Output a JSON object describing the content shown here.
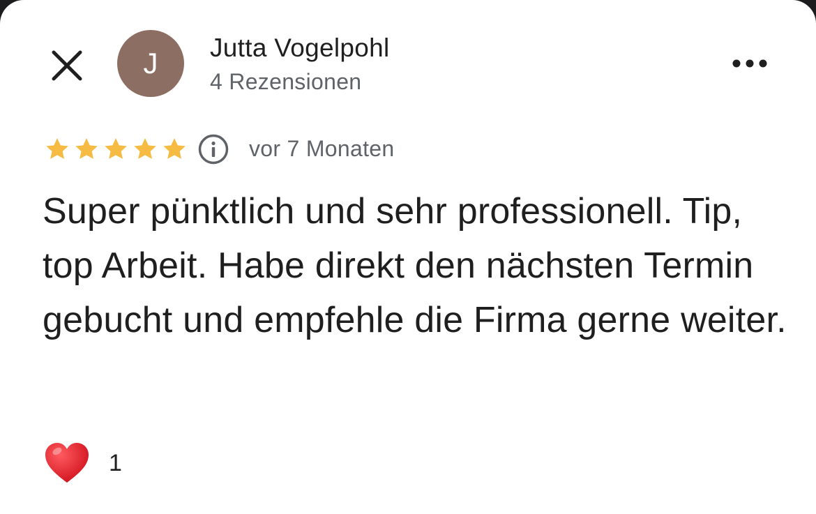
{
  "review": {
    "author_name": "Jutta Vogelpohl",
    "author_initial": "J",
    "author_reviews": "4 Rezensionen",
    "rating": 5,
    "rating_max": 5,
    "date": "vor 7 Monaten",
    "text": "Super pünktlich und sehr professionell. Tip, top Arbeit. Habe direkt den nächsten Termin gebucht und empfehle die Firma gerne weiter.",
    "reaction_count": "1"
  },
  "icons": {
    "close": "close-icon",
    "more": "more-horizontal-icon",
    "info": "info-icon",
    "star": "star-icon",
    "heart": "heart-icon"
  },
  "colors": {
    "avatar_bg": "#8d6e63",
    "star": "#f6bb42",
    "heart": "#e0212c",
    "text_primary": "#1f1f1f",
    "text_secondary": "#5f6368"
  }
}
